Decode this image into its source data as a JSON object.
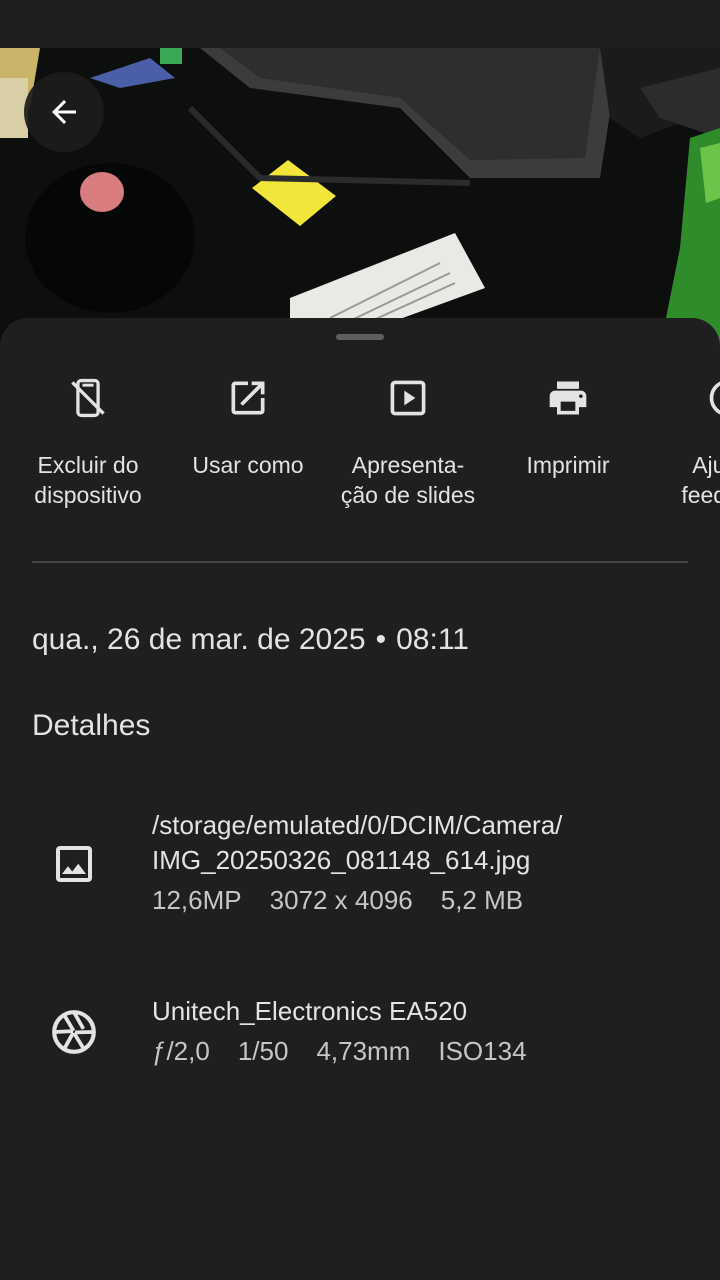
{
  "actions": [
    {
      "icon": "phone-off-icon",
      "label": "Excluir do\ndispositivo"
    },
    {
      "icon": "open-external-icon",
      "label": "Usar como"
    },
    {
      "icon": "slideshow-icon",
      "label": "Apresenta-\nção de slides"
    },
    {
      "icon": "print-icon",
      "label": "Imprimir"
    },
    {
      "icon": "feedback-icon",
      "label": "Ajustar\nfeedback"
    }
  ],
  "date": {
    "day": "qua., 26 de mar. de 2025",
    "separator": "•",
    "time": "08:11"
  },
  "details_title": "Detalhes",
  "file": {
    "icon": "image-icon",
    "path_line1": "/storage/emulated/0/DCIM/Camera/",
    "path_line2": "IMG_20250326_081148_614.jpg",
    "megapixels": "12,6MP",
    "resolution": "3072 x 4096",
    "size": "5,2 MB"
  },
  "camera": {
    "icon": "aperture-icon",
    "model": "Unitech_Electronics EA520",
    "aperture": "ƒ/2,0",
    "shutter": "1/50",
    "focal_length": "4,73mm",
    "iso": "ISO134"
  },
  "colors": {
    "background": "#1f1f1f",
    "text_primary": "#e3e3e3",
    "text_secondary": "#c4c7c5",
    "divider": "#444746"
  }
}
